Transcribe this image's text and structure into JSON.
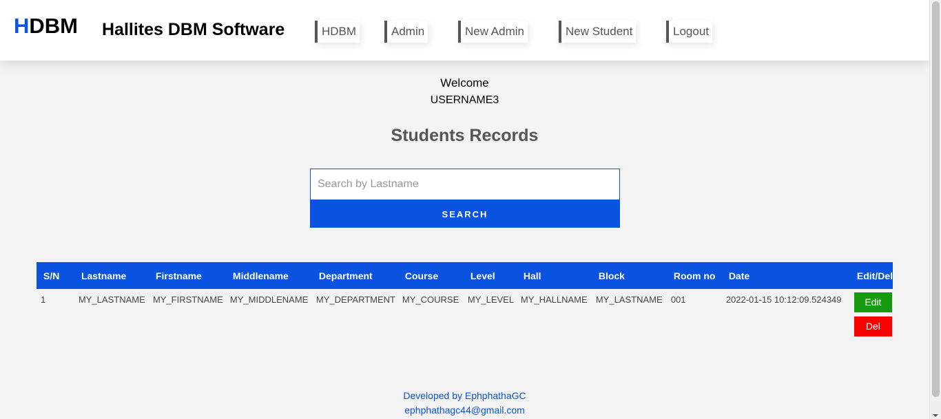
{
  "header": {
    "logo": {
      "first": "H",
      "rest": "DBM"
    },
    "brand": "Hallites DBM Software",
    "nav": [
      "HDBM",
      "Admin",
      "New Admin",
      "New Student",
      "Logout"
    ]
  },
  "welcome": {
    "greeting": "Welcome",
    "username": "USERNAME3"
  },
  "page_title": "Students Records",
  "search": {
    "placeholder": "Search by Lastname",
    "value": "",
    "button": "SEARCH"
  },
  "table": {
    "headers": [
      "S/N",
      "Lastname",
      "Firstname",
      "Middlename",
      "Department",
      "Course",
      "Level",
      "Hall",
      "Block",
      "Room no",
      "Date",
      "Edit/Del"
    ],
    "rows": [
      {
        "sn": "1",
        "lastname": "MY_LASTNAME",
        "firstname": "MY_FIRSTNAME",
        "middlename": "MY_MIDDLENAME",
        "department": "MY_DEPARTMENT",
        "course": "MY_COURSE",
        "level": "MY_LEVEL",
        "hall": "MY_HALLNAME",
        "block": "MY_LASTNAME",
        "room": "001",
        "date": "2022-01-15 10:12:09.524349",
        "edit_label": "Edit",
        "del_label": "Del"
      }
    ]
  },
  "footer": {
    "credit": "Developed by EphphathaGC",
    "email": "ephphathagc44@gmail.com"
  },
  "colors": {
    "accent": "#0a53e0",
    "edit": "#179a10",
    "delete": "#fb0000"
  }
}
